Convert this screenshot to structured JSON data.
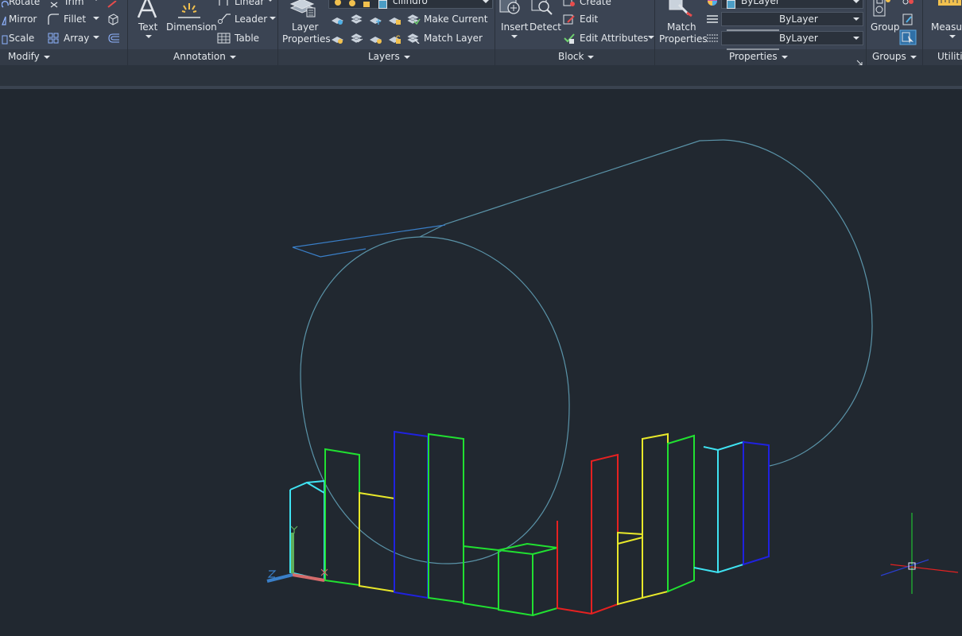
{
  "modify": {
    "rotate": "Rotate",
    "trim": "Trim",
    "mirror": "Mirror",
    "fillet": "Fillet",
    "scale": "Scale",
    "array": "Array",
    "panel_label": "Modify"
  },
  "annotation": {
    "text": "Text",
    "dimension": "Dimension",
    "linear": "Linear",
    "leader": "Leader",
    "table": "Table",
    "panel_label": "Annotation"
  },
  "layers": {
    "layer_properties_line1": "Layer",
    "layer_properties_line2": "Properties",
    "current_layer": "cilindro",
    "make_current": "Make Current",
    "match_layer": "Match Layer",
    "panel_label": "Layers"
  },
  "block": {
    "insert": "Insert",
    "detect": "Detect",
    "create": "Create",
    "edit": "Edit",
    "edit_attributes": "Edit Attributes",
    "panel_label": "Block"
  },
  "properties": {
    "match_line1": "Match",
    "match_line2": "Properties",
    "color_value": "ByLayer",
    "linetype_value": "ByLayer",
    "lineweight_value": "ByLayer",
    "panel_label": "Properties"
  },
  "groups": {
    "group": "Group",
    "panel_label": "Groups"
  },
  "utilities": {
    "measure": "Measure",
    "panel_label": "Utilities"
  },
  "colors": {
    "cylinder": "#5a93a8",
    "cyan": "#3fe3f2",
    "green": "#21e031",
    "yellow": "#e8e82a",
    "blue": "#1f22e0",
    "red": "#e62121",
    "ucs_x": "#d46b6b",
    "ucs_y": "#5fae5a",
    "ucs_z": "#3a7fc8"
  }
}
